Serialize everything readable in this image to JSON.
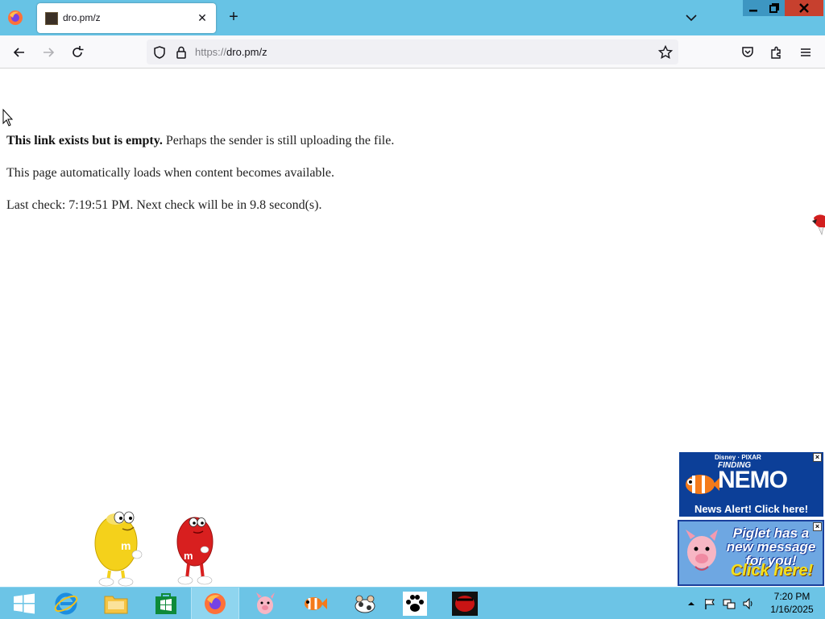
{
  "browser": {
    "tab_title": "dro.pm/z",
    "url_scheme": "https://",
    "url_host": "dro.pm/z"
  },
  "page": {
    "line1_bold": "This link exists but is empty.",
    "line1_rest": " Perhaps the sender is still uploading the file.",
    "line2": "This page automatically loads when content becomes available.",
    "line3": "Last check: 7:19:51 PM. Next check will be in 9.8 second(s)."
  },
  "ads": {
    "nemo": {
      "brand": "Disney · PIXAR",
      "finding": "FINDING",
      "title": "NEMO",
      "alert": "News Alert! Click here!"
    },
    "piglet": {
      "message": "Piglet has a new message for you!",
      "cta": "Click here!"
    }
  },
  "taskbar": {
    "time": "7:20 PM",
    "date": "1/16/2025",
    "apps": [
      "start",
      "internet-explorer",
      "file-explorer",
      "store",
      "firefox",
      "piglet",
      "nemo",
      "cows",
      "paw",
      "red-app"
    ]
  },
  "colors": {
    "titlebar": "#67c3e5",
    "taskbar": "#6cc4e6",
    "close": "#c7402e"
  }
}
